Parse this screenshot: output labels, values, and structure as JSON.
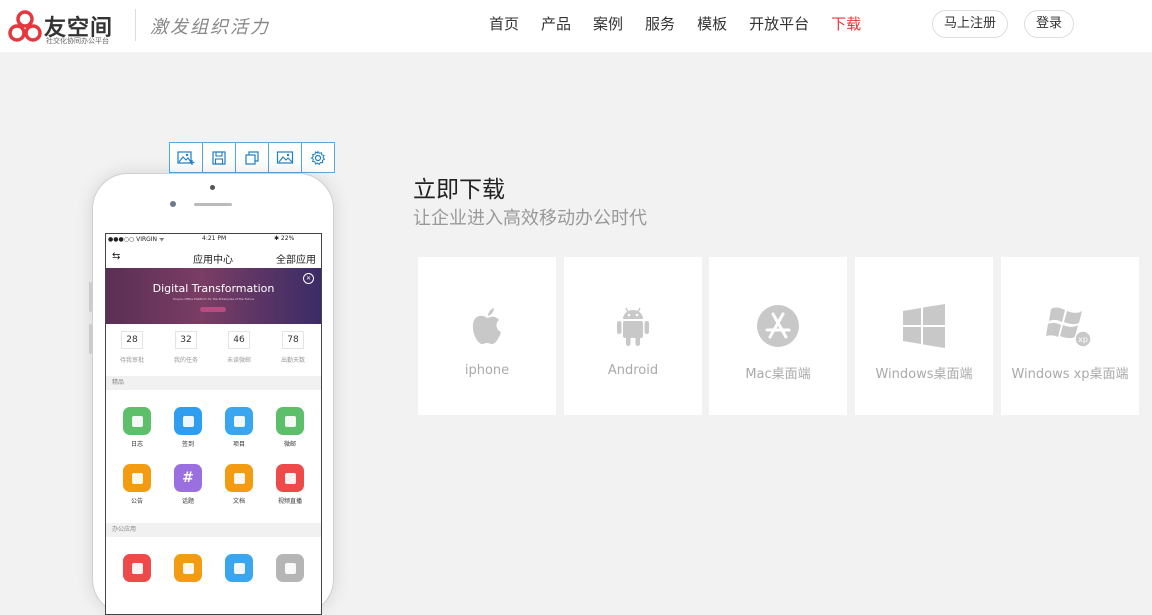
{
  "header": {
    "logo_title": "友空间",
    "logo_subtitle": "社交化协同办公平台",
    "slogan": "激发组织活力",
    "nav": [
      {
        "label": "首页",
        "active": false
      },
      {
        "label": "产品",
        "active": false
      },
      {
        "label": "案例",
        "active": false
      },
      {
        "label": "服务",
        "active": false
      },
      {
        "label": "模板",
        "active": false
      },
      {
        "label": "开放平台",
        "active": false
      },
      {
        "label": "下载",
        "active": true
      }
    ],
    "register_label": "马上注册",
    "login_label": "登录"
  },
  "toolbar": {
    "icons": [
      "add-image-icon",
      "save-icon",
      "copy-icon",
      "image-icon",
      "settings-icon"
    ]
  },
  "phone": {
    "status": {
      "carrier": "●●●○○ VIRGIN ᯤ",
      "time": "4:21 PM",
      "battery": "✱ 22%"
    },
    "header": {
      "back": "⇆",
      "title": "应用中心",
      "all_apps": "全部应用"
    },
    "banner": {
      "title": "Digital Transformation",
      "subtitle": "Yonyou Office Platform for the Enterprise of the Future"
    },
    "stats": [
      {
        "value": "28",
        "label": "待我审批"
      },
      {
        "value": "32",
        "label": "我的任务"
      },
      {
        "value": "46",
        "label": "未读微邮"
      },
      {
        "value": "78",
        "label": "出勤天数"
      }
    ],
    "section_featured": "精品",
    "featured_apps": [
      {
        "label": "日志",
        "color": "#5dbf6a"
      },
      {
        "label": "签到",
        "color": "#2f9df0"
      },
      {
        "label": "项目",
        "color": "#3aa6f0"
      },
      {
        "label": "微邮",
        "color": "#5dbf6a"
      },
      {
        "label": "公告",
        "color": "#f39c12"
      },
      {
        "label": "话题",
        "color": "#9b6fe0"
      },
      {
        "label": "文档",
        "color": "#f39c12"
      },
      {
        "label": "视频直播",
        "color": "#ef4a4a"
      }
    ],
    "section_office": "办公应用",
    "office_apps": [
      {
        "color": "#ef4a4a"
      },
      {
        "color": "#f39c12"
      },
      {
        "color": "#3aa6f0"
      },
      {
        "color": "#b5b5b5"
      }
    ]
  },
  "download": {
    "title": "立即下载",
    "subtitle": "让企业进入高效移动办公时代",
    "platforms": [
      {
        "label": "iphone",
        "icon": "apple-icon"
      },
      {
        "label": "Android",
        "icon": "android-icon"
      },
      {
        "label": "Mac桌面端",
        "icon": "app-store-icon"
      },
      {
        "label": "Windows桌面端",
        "icon": "windows-icon"
      },
      {
        "label": "Windows xp桌面端",
        "icon": "windows-xp-icon"
      }
    ]
  },
  "colors": {
    "brand_red": "#e5383e",
    "toolbar_blue": "#52a9e6",
    "icon_gray": "#c8c8c8",
    "page_bg": "#f2f2f2"
  }
}
